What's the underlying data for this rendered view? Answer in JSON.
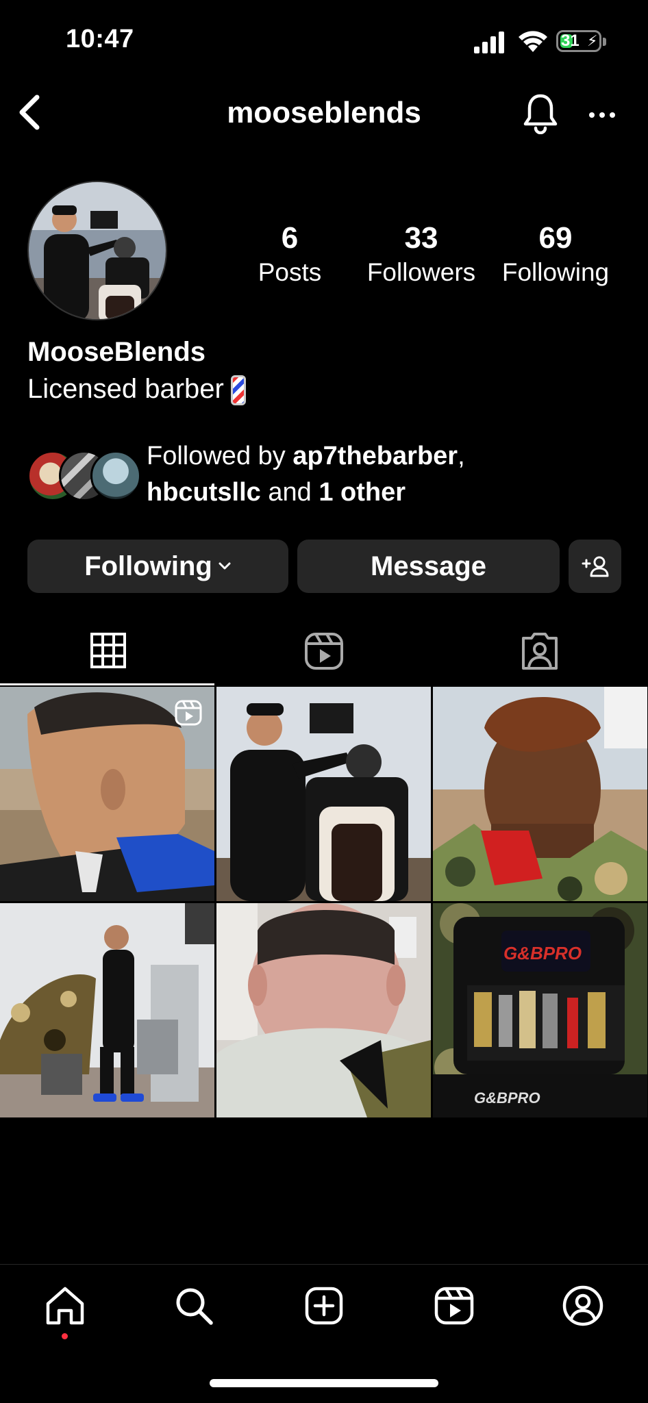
{
  "status_bar": {
    "time": "10:47",
    "battery": "31"
  },
  "header": {
    "username": "mooseblends"
  },
  "profile": {
    "stats": [
      {
        "value": "6",
        "label": "Posts"
      },
      {
        "value": "33",
        "label": "Followers"
      },
      {
        "value": "69",
        "label": "Following"
      }
    ],
    "display_name": "MooseBlends",
    "bio": "Licensed barber",
    "followed_by": {
      "prefix": "Followed by ",
      "user1": "ap7thebarber",
      "sep": ",",
      "user2": "hbcutsllc",
      "mid": " and ",
      "others": "1 other"
    }
  },
  "actions": {
    "following_label": "Following",
    "message_label": "Message"
  },
  "tabs": [
    "grid-icon",
    "reels-icon",
    "tagged-icon"
  ],
  "posts": [
    {
      "name": "post-1",
      "type": "reel"
    },
    {
      "name": "post-2",
      "type": "photo"
    },
    {
      "name": "post-3",
      "type": "photo"
    },
    {
      "name": "post-4",
      "type": "photo"
    },
    {
      "name": "post-5",
      "type": "photo"
    },
    {
      "name": "post-6",
      "type": "photo"
    }
  ],
  "bottom_nav": [
    "home-icon",
    "search-icon",
    "create-icon",
    "reels-icon",
    "profile-icon"
  ],
  "colors": {
    "background": "#000000",
    "button": "#262626",
    "battery": "#30d158",
    "notification_dot": "#ff3040"
  }
}
